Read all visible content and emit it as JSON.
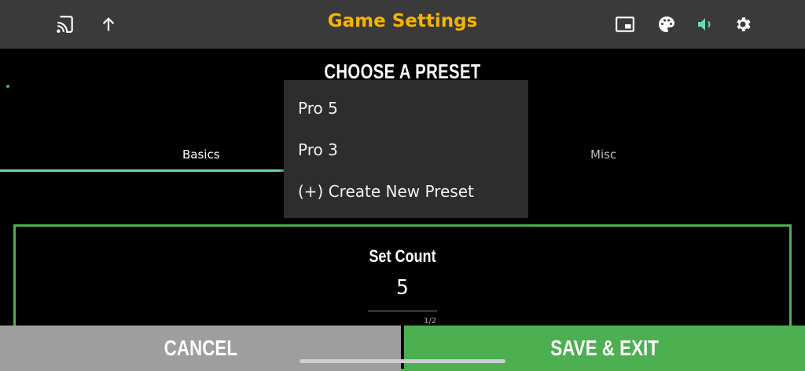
{
  "header": {
    "title": "Game Settings",
    "title_color": "#f5b400",
    "icons": [
      "cast-icon",
      "arrow-up-icon",
      "picture-in-picture-icon",
      "palette-icon",
      "volume-icon",
      "settings-gear-icon"
    ],
    "volume_icon_color": "#6fd6b5"
  },
  "preset": {
    "title": "CHOOSE A PRESET"
  },
  "tabs": [
    {
      "label": "Basics",
      "active": true
    },
    {
      "label": "Misc",
      "active": false
    }
  ],
  "card": {
    "label": "Set Count",
    "value": "5",
    "hint": "1/2"
  },
  "menu": {
    "items": [
      "Pro 5",
      "Pro 3",
      "(+) Create New Preset"
    ]
  },
  "footer": {
    "cancel_label": "CANCEL",
    "save_label": "SAVE & EXIT"
  },
  "colors": {
    "accent_green": "#4caf50",
    "tab_underline": "#6fd6b5",
    "cancel_bg": "#9e9e9e"
  }
}
